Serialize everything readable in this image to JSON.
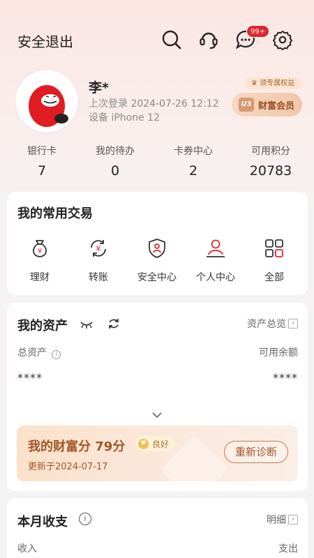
{
  "header": {
    "logout_label": "安全退出",
    "message_badge": "99+",
    "icons": [
      "search-icon",
      "customer-service-icon",
      "message-icon",
      "settings-icon"
    ]
  },
  "profile": {
    "name": "李*",
    "last_login": "上次登录 2024-07-26 12:12",
    "device": "设备 iPhone 12",
    "perk_tag": "领专属权益",
    "member_level": "U3",
    "member_label": "财富会员"
  },
  "stats": [
    {
      "label": "银行卡",
      "value": "7"
    },
    {
      "label": "我的待办",
      "value": "0"
    },
    {
      "label": "卡券中心",
      "value": "2"
    },
    {
      "label": "可用积分",
      "value": "20783"
    }
  ],
  "frequent": {
    "title": "我的常用交易",
    "items": [
      {
        "label": "理财",
        "icon": "money-bag-icon"
      },
      {
        "label": "转账",
        "icon": "transfer-icon"
      },
      {
        "label": "安全中心",
        "icon": "shield-user-icon"
      },
      {
        "label": "个人中心",
        "icon": "person-icon"
      },
      {
        "label": "全部",
        "icon": "grid-icon"
      }
    ]
  },
  "assets": {
    "title": "我的资产",
    "overview_link": "资产总览",
    "total_label": "总资产",
    "available_label": "可用余额",
    "total_value": "****",
    "available_value": "****",
    "wealth_score": "我的财富分 79分",
    "wealth_grade": "良好",
    "wealth_updated": "更新于2024-07-17",
    "rediagnose_label": "重新诊断"
  },
  "monthly": {
    "title": "本月收支",
    "detail_link": "明细",
    "income_label": "收入",
    "expense_label": "支出"
  },
  "colors": {
    "brand_red": "#e0262b",
    "gold_text": "#a2562a"
  }
}
